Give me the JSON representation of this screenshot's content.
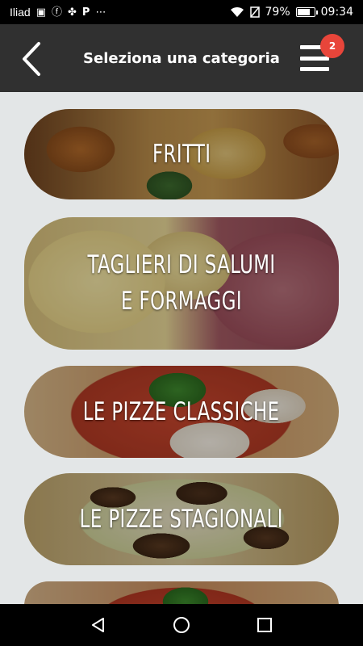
{
  "status_bar": {
    "carrier": "Iliad",
    "battery_percent": "79%",
    "battery_level": 0.79,
    "time": "09:34",
    "notification_icons": [
      "gallery-icon",
      "facebook-icon",
      "pinwheel-icon",
      "paypal-icon",
      "more-dots-icon"
    ]
  },
  "header": {
    "title": "Seleziona una categoria",
    "cart_badge_count": "2"
  },
  "categories": [
    {
      "label": "FRITTI"
    },
    {
      "label": "TAGLIERI DI SALUMI E FORMAGGI"
    },
    {
      "label": "LE PIZZE CLASSICHE"
    },
    {
      "label": "LE PIZZE STAGIONALI"
    },
    {
      "label": ""
    }
  ],
  "colors": {
    "header_bg": "#303030",
    "page_bg": "#e3e6e7",
    "badge": "#e8453a"
  }
}
